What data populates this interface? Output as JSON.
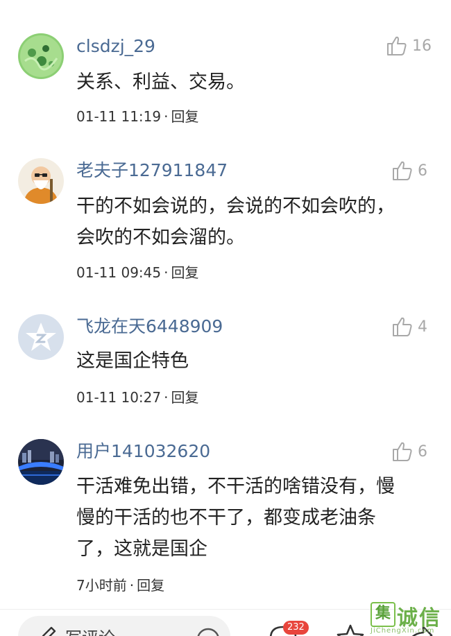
{
  "comments": [
    {
      "username": "clsdzj_29",
      "likes": "16",
      "text_lines": [
        "关系、利益、交易。"
      ],
      "time": "01-11 11:19",
      "dot": "·",
      "reply": "回复"
    },
    {
      "username": "老夫子127911847",
      "likes": "6",
      "text_lines": [
        "干的不如会说的，会说的不如会吹的，",
        "会吹的不如会溜的。"
      ],
      "time": "01-11 09:45",
      "dot": "·",
      "reply": "回复"
    },
    {
      "username": "飞龙在天6448909",
      "likes": "4",
      "text_lines": [
        "这是国企特色"
      ],
      "time": "01-11 10:27",
      "dot": "·",
      "reply": "回复"
    },
    {
      "username": "用户141032620",
      "likes": "6",
      "text_lines": [
        "干活难免出错，不干活的啥错没有，慢",
        "慢的干活的也不干了，都变成老油条",
        "了，这就是国企"
      ],
      "time": "7小时前",
      "dot": "·",
      "reply": "回复"
    }
  ],
  "bottom_bar": {
    "comment_placeholder": "写评论",
    "comment_count_badge": "232"
  },
  "watermark": {
    "box_char": "集",
    "name": "诚信",
    "sub": "JiChengXin.com"
  },
  "colors": {
    "username": "#4a6a93",
    "like_gray": "#a8a8a8",
    "badge_red": "#e8453c",
    "watermark_green": "#6cb04a"
  },
  "icons": {
    "like": "thumbs-up-icon",
    "pen": "pen-icon",
    "emoji": "emoji-icon",
    "comments": "comment-bubble-icon",
    "favorite": "star-icon",
    "share": "share-icon"
  }
}
